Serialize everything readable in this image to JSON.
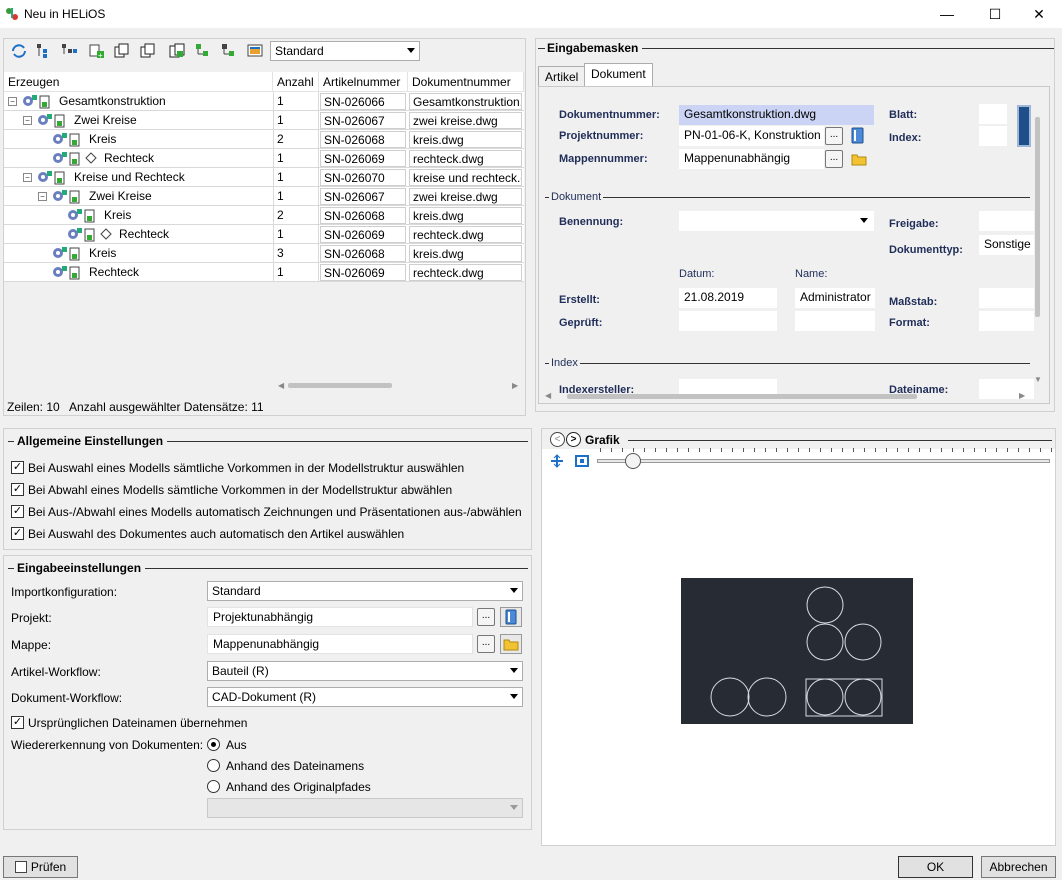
{
  "window": {
    "title": "Neu in HELiOS",
    "minimize": "—",
    "maximize": "☐",
    "close": "✕"
  },
  "toolbar": {
    "view_combo": "Standard"
  },
  "grid": {
    "columns": [
      "Erzeugen",
      "Anzahl",
      "Artikelnummer",
      "Dokumentnummer"
    ],
    "rows": [
      {
        "name": "Gesamtkonstruktion",
        "qty": "1",
        "article": "SN-026066",
        "doc": "Gesamtkonstruktion."
      },
      {
        "name": "Zwei Kreise",
        "qty": "1",
        "article": "SN-026067",
        "doc": "zwei kreise.dwg"
      },
      {
        "name": "Kreis",
        "qty": "2",
        "article": "SN-026068",
        "doc": "kreis.dwg"
      },
      {
        "name": "Rechteck",
        "qty": "1",
        "article": "SN-026069",
        "doc": "rechteck.dwg"
      },
      {
        "name": "Kreise und Rechteck",
        "qty": "1",
        "article": "SN-026070",
        "doc": "kreise und rechteck.d"
      },
      {
        "name": "Zwei Kreise",
        "qty": "1",
        "article": "SN-026067",
        "doc": "zwei kreise.dwg"
      },
      {
        "name": "Kreis",
        "qty": "2",
        "article": "SN-026068",
        "doc": "kreis.dwg"
      },
      {
        "name": "Rechteck",
        "qty": "1",
        "article": "SN-026069",
        "doc": "rechteck.dwg"
      },
      {
        "name": "Kreis",
        "qty": "3",
        "article": "SN-026068",
        "doc": "kreis.dwg"
      },
      {
        "name": "Rechteck",
        "qty": "1",
        "article": "SN-026069",
        "doc": "rechteck.dwg"
      }
    ],
    "status": "Zeilen: 10   Anzahl ausgewählter Datensätze: 11"
  },
  "eingabemasken": {
    "title": "Eingabemasken",
    "tabs": [
      "Artikel",
      "Dokument"
    ],
    "active_tab": "Dokument",
    "dokumentnummer_label": "Dokumentnummer:",
    "dokumentnummer_value": "Gesamtkonstruktion.dwg",
    "projektnummer_label": "Projektnummer:",
    "projektnummer_value": "PN-01-06-K, Konstruktion",
    "mappennummer_label": "Mappennummer:",
    "mappennummer_value": "Mappenunabhängig",
    "blatt_label": "Blatt:",
    "index_label": "Index:",
    "section_dokument": "Dokument",
    "benennung_label": "Benennung:",
    "freigabe_label": "Freigabe:",
    "dokumenttyp_label": "Dokumenttyp:",
    "dokumenttyp_value": "Sonstige",
    "datum_header": "Datum:",
    "name_header": "Name:",
    "erstellt_label": "Erstellt:",
    "erstellt_date": "21.08.2019",
    "erstellt_name": "Administrator",
    "geprueft_label": "Geprüft:",
    "massstab_label": "Maßstab:",
    "format_label": "Format:",
    "section_index": "Index",
    "indexersteller_label": "Indexersteller:",
    "dateiname_label": "Dateiname:",
    "dots": "..."
  },
  "allgemein": {
    "title": "Allgemeine Einstellungen",
    "options": [
      {
        "label": "Bei Auswahl eines Modells sämtliche Vorkommen in der Modellstruktur auswählen",
        "checked": true
      },
      {
        "label": "Bei Abwahl eines Modells sämtliche Vorkommen in der Modellstruktur abwählen",
        "checked": true
      },
      {
        "label": "Bei Aus-/Abwahl eines Modells automatisch Zeichnungen und Präsentationen aus-/abwählen",
        "checked": true
      },
      {
        "label": "Bei Auswahl des Dokumentes auch automatisch den Artikel auswählen",
        "checked": true
      }
    ]
  },
  "eingabe": {
    "title": "Eingabeeinstellungen",
    "import_label": "Importkonfiguration:",
    "import_value": "Standard",
    "projekt_label": "Projekt:",
    "projekt_value": "Projektunabhängig",
    "mappe_label": "Mappe:",
    "mappe_value": "Mappenunabhängig",
    "artikel_wf_label": "Artikel-Workflow:",
    "artikel_wf_value": "Bauteil (R)",
    "dokument_wf_label": "Dokument-Workflow:",
    "dokument_wf_value": "CAD-Dokument (R)",
    "orig_name_label": "Ursprünglichen Dateinamen übernehmen",
    "orig_name_checked": true,
    "wieder_label": "Wiedererkennung von Dokumenten:",
    "radio_options": [
      "Aus",
      "Anhand des Dateinamens",
      "Anhand des Originalpfades"
    ],
    "radio_selected": "Aus",
    "dots": "..."
  },
  "grafik": {
    "title": "Grafik",
    "slider_value": 0.0
  },
  "buttons": {
    "pruefen": "Prüfen",
    "ok": "OK",
    "abbrechen": "Abbrechen"
  },
  "colors": {
    "accent_field": "#ccd4f5",
    "preview_bg": "#262b34",
    "preview_stroke": "#d8dce4"
  }
}
